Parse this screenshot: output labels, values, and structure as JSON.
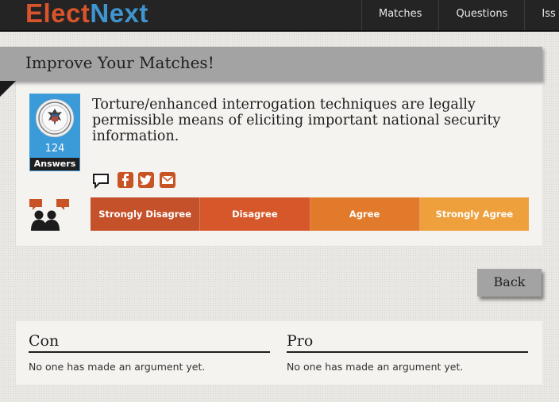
{
  "brand": {
    "part1": "Elect",
    "part2": "Next",
    "color1": "#d9532b",
    "color2": "#3f95cf"
  },
  "nav": {
    "items": [
      "Matches",
      "Questions",
      "Iss"
    ]
  },
  "banner": {
    "title": "Improve Your Matches!"
  },
  "question": {
    "text": "Torture/enhanced interrogation techniques are legally permissible means of eliciting important national security information.",
    "answer_count": "124",
    "answer_label": "Answers",
    "seal_icon": "presidential-seal-icon"
  },
  "share": {
    "icons": [
      "comment-icon",
      "facebook-icon",
      "twitter-icon",
      "email-icon"
    ]
  },
  "scale": {
    "options": [
      "Strongly Disagree",
      "Disagree",
      "Agree",
      "Strongly Agree"
    ],
    "colors": [
      "#c5512a",
      "#d6582a",
      "#e27a2c",
      "#eea03d"
    ]
  },
  "back": {
    "label": "Back"
  },
  "arguments": {
    "con_title": "Con",
    "pro_title": "Pro",
    "con_empty": "No one has made an argument yet.",
    "pro_empty": "No one has made an argument yet."
  }
}
